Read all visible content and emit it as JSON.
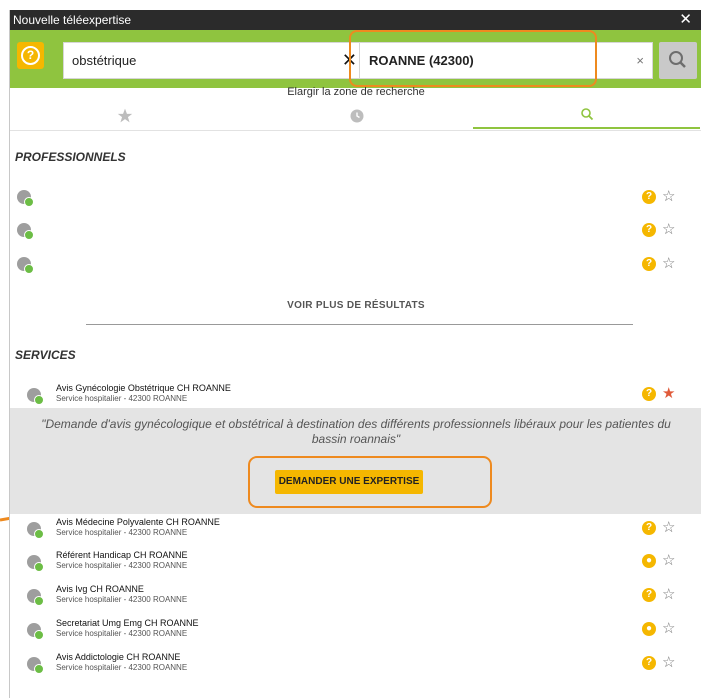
{
  "window": {
    "title": "Nouvelle téléexpertise",
    "close": "✕"
  },
  "search": {
    "help_icon": "help-circle-icon",
    "query_value": "obstétrique",
    "query_clear": "✕",
    "location_value": "ROANNE (42300)",
    "location_clear": "×",
    "search_icon": "search-icon",
    "enlarge_label": "Elargir la zone de recherche"
  },
  "tabs": [
    {
      "icon": "star-icon",
      "active": false
    },
    {
      "icon": "clock-icon",
      "active": false
    },
    {
      "icon": "search-icon",
      "active": true
    }
  ],
  "professionals": {
    "title": "PROFESSIONNELS",
    "rows": [
      {},
      {},
      {}
    ],
    "more_label": "VOIR PLUS DE RÉSULTATS"
  },
  "services": {
    "title": "SERVICES",
    "items": [
      {
        "name": "Avis Gynécologie Obstétrique CH ROANNE",
        "sub": "Service hospitalier - 42300 ROANNE",
        "status": "help",
        "favorite": true
      },
      {
        "name": "Avis Médecine Polyvalente CH ROANNE",
        "sub": "Service hospitalier - 42300 ROANNE",
        "status": "help",
        "favorite": false
      },
      {
        "name": "Référent Handicap CH ROANNE",
        "sub": "Service hospitalier - 42300 ROANNE",
        "status": "group",
        "favorite": false
      },
      {
        "name": "Avis Ivg CH ROANNE",
        "sub": "Service hospitalier - 42300 ROANNE",
        "status": "help",
        "favorite": false
      },
      {
        "name": "Secretariat Umg Emg CH ROANNE",
        "sub": "Service hospitalier - 42300 ROANNE",
        "status": "group",
        "favorite": false
      },
      {
        "name": "Avis Addictologie CH ROANNE",
        "sub": "Service hospitalier - 42300 ROANNE",
        "status": "help",
        "favorite": false
      }
    ],
    "selected_description": "\"Demande d'avis gynécologique et obstétrical à destination des différents professionnels libéraux pour les patientes du bassin roannais\"",
    "request_button": "DEMANDER UNE EXPERTISE"
  },
  "colors": {
    "accent_green": "#8fc43f",
    "accent_yellow": "#f5b700",
    "annotation_orange": "#ee8a1f",
    "favorite_red": "#e05a3a"
  }
}
